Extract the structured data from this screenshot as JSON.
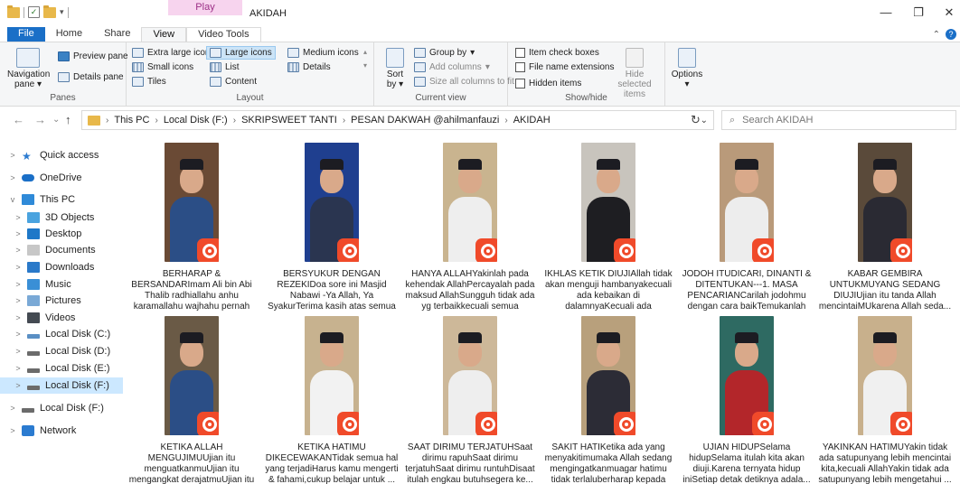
{
  "window": {
    "context_tab": "Play",
    "title": "AKIDAH",
    "controls": {
      "minimize": "—",
      "maximize": "❐",
      "close": "✕"
    }
  },
  "tabs": [
    "File",
    "Home",
    "Share",
    "View",
    "Video Tools"
  ],
  "ribbon": {
    "panes": {
      "navigation": "Navigation pane",
      "preview": "Preview pane",
      "details": "Details pane",
      "label": "Panes"
    },
    "layout": {
      "items": [
        "Extra large icons",
        "Large icons",
        "Medium icons",
        "Small icons",
        "List",
        "Details",
        "Tiles",
        "Content"
      ],
      "selected": "Large icons",
      "label": "Layout"
    },
    "current_view": {
      "sort": "Sort by",
      "group": "Group by",
      "add_columns": "Add columns",
      "size_columns": "Size all columns to fit",
      "label": "Current view"
    },
    "show_hide": {
      "item_checkboxes": "Item check boxes",
      "file_ext": "File name extensions",
      "hidden": "Hidden items",
      "hide_selected": "Hide selected items",
      "label": "Show/hide"
    },
    "options": "Options"
  },
  "address": {
    "path": [
      "This PC",
      "Local Disk (F:)",
      "SKRIPSWEET TANTI",
      "PESAN DAKWAH @ahilmanfauzi",
      "AKIDAH"
    ],
    "search_placeholder": "Search AKIDAH"
  },
  "nav": [
    {
      "label": "Quick access",
      "icon": "star-icon",
      "color": "#2b7bd0",
      "exp": ">",
      "indent": 0
    },
    {
      "label": "OneDrive",
      "icon": "cloud-icon",
      "color": "#1a6fc7",
      "exp": ">",
      "indent": 0
    },
    {
      "label": "This PC",
      "icon": "monitor-icon",
      "color": "#2f8ad8",
      "exp": "v",
      "indent": 0
    },
    {
      "label": "3D Objects",
      "icon": "cube-icon",
      "color": "#4aa3df",
      "exp": ">",
      "indent": 1
    },
    {
      "label": "Desktop",
      "icon": "desktop-icon",
      "color": "#1e78c8",
      "exp": ">",
      "indent": 1
    },
    {
      "label": "Documents",
      "icon": "document-icon",
      "color": "#c7c7c7",
      "exp": ">",
      "indent": 1
    },
    {
      "label": "Downloads",
      "icon": "download-icon",
      "color": "#2a79c9",
      "exp": ">",
      "indent": 1
    },
    {
      "label": "Music",
      "icon": "music-icon",
      "color": "#3a8fd6",
      "exp": ">",
      "indent": 1
    },
    {
      "label": "Pictures",
      "icon": "picture-icon",
      "color": "#7aa9d6",
      "exp": ">",
      "indent": 1
    },
    {
      "label": "Videos",
      "icon": "video-icon",
      "color": "#444a52",
      "exp": ">",
      "indent": 1
    },
    {
      "label": "Local Disk (C:)",
      "icon": "drive-icon",
      "color": "#5a8fc4",
      "exp": ">",
      "indent": 1
    },
    {
      "label": "Local Disk (D:)",
      "icon": "drive-icon",
      "color": "#6b6b6b",
      "exp": ">",
      "indent": 1
    },
    {
      "label": "Local Disk (E:)",
      "icon": "drive-icon",
      "color": "#6b6b6b",
      "exp": ">",
      "indent": 1
    },
    {
      "label": "Local Disk (F:)",
      "icon": "drive-icon",
      "color": "#6b6b6b",
      "exp": ">",
      "indent": 1,
      "selected": true
    },
    {
      "label": "Local Disk (F:)",
      "icon": "drive-icon",
      "color": "#6b6b6b",
      "exp": ">",
      "indent": 0
    },
    {
      "label": "Network",
      "icon": "network-icon",
      "color": "#2b7bd0",
      "exp": ">",
      "indent": 0
    }
  ],
  "files": [
    {
      "label": "BERHARAP & BERSANDARImam Ali bin Abi Thalib radhiallahu anhu karamallahu wajhahu pernah berkata -'Aku pernah m...",
      "bg": "#6a4a35",
      "robe": "#2b4e86"
    },
    {
      "label": "BERSYUKUR DENGAN REZEKIDoa sore ini Masjid Nabawi -Ya Allah, Ya SyakurTerima kasih atas semua rezekiMUTanamkan rasa syukur ...",
      "bg": "#1f3f8f",
      "robe": "#2a3550"
    },
    {
      "label": "HANYA ALLAHYakinlah pada kehendak AllahPercayalah pada maksud AllahSungguh tidak ada yg terbaikkecuali semua datang...",
      "bg": "#c9b48f",
      "robe": "#eeeeee"
    },
    {
      "label": "IKHLAS KETIK DIUJIAllah tidak akan menguji hambanyakecuali ada kebaikan di dalamnyaKecuali ada kebahagiaan yang dijanjika...",
      "bg": "#c8c4bd",
      "robe": "#1e1e22"
    },
    {
      "label": "JODOH ITUDICARI, DINANTI & DITENTUKAN---1. MASA PENCARIANCarilah jodohmu dengan cara baikTemukanlah jo...",
      "bg": "#b99a7a",
      "robe": "#ededed"
    },
    {
      "label": "KABAR GEMBIRA UNTUKMUYANG SEDANG DIUJIUjian itu tanda Allah mencintaiMUkarena Allah seda...",
      "bg": "#5a4a3a",
      "robe": "#2a2a33"
    },
    {
      "label": "KETIKA ALLAH MENGUJIMUUjian itu menguatkanmuUjian itu mengangkat derajatmuUjian itu mengampunkan dosamuJanga...",
      "bg": "#6a5a46",
      "robe": "#2b4e86"
    },
    {
      "label": "KETIKA HATIMU DIKECEWAKANTidak semua hal yang terjadiHarus kamu mengerti & fahami,cukup belajar untuk ...",
      "bg": "#c7b28f",
      "robe": "#f2f2f2"
    },
    {
      "label": "SAAT DIRIMU TERJATUHSaat dirimu rapuhSaat dirimu terjatuhSaat dirimu runtuhDisaat itulah engkau butuhsegera ke...",
      "bg": "#cdb899",
      "robe": "#eeeeee"
    },
    {
      "label": "SAKIT HATIKetika ada yang menyakitimumaka Allah sedang mengingatkanmuagar hatimu tidak terlaluberharap kepada se...",
      "bg": "#b8a07c",
      "robe": "#2c2c36"
    },
    {
      "label": "UJIAN HIDUPSelama hidupSelama itulah kita akan diuji.Karena ternyata hidup iniSetiap detak detiknya adala...",
      "bg": "#2e6a62",
      "robe": "#b3262a"
    },
    {
      "label": "YAKINKAN HATIMUYakin tidak ada satupunyang lebih mencintai kita,kecuali AllahYakin tidak ada satupunyang lebih mengetahui ...",
      "bg": "#c8b08c",
      "robe": "#f0f0f0"
    }
  ]
}
